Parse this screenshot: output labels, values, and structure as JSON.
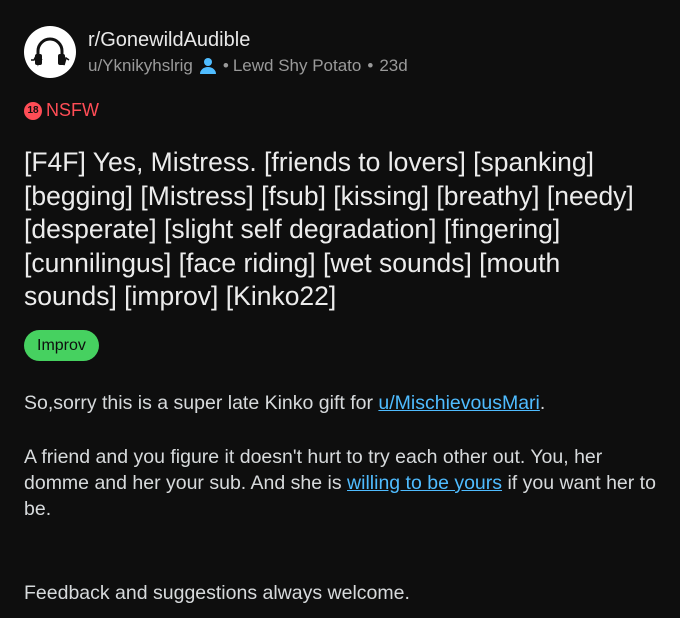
{
  "post": {
    "subreddit": "r/GonewildAudible",
    "author": "u/Yknikyhslrig",
    "author_flair": "Lewd Shy Potato",
    "separator": "•",
    "age": "23d",
    "nsfw_badge": "18",
    "nsfw_label": "NSFW",
    "title": "[F4F] Yes, Mistress. [friends to lovers] [spanking] [begging] [Mistress] [fsub] [kissing] [breathy] [needy] [desperate] [slight self degradation] [fingering] [cunnilingus] [face riding] [wet sounds] [mouth sounds] [improv] [Kinko22]",
    "link_flair": "Improv",
    "body": {
      "p1_before": "So,sorry this is a super late Kinko gift for ",
      "p1_link": "u/MischievousMari",
      "p1_after": ".",
      "p2_before": "A friend and you figure it doesn't hurt to try each other out. You, her domme and her your sub. And she is ",
      "p2_link": "willing to be yours",
      "p2_after": " if you want her to be.",
      "p3": "Feedback and suggestions always welcome."
    }
  },
  "colors": {
    "background": "#0e0e0e",
    "nsfw": "#ff4d56",
    "flair": "#46d160",
    "link": "#4fbcff",
    "user_icon": "#4fbcff"
  },
  "icons": {
    "subreddit_avatar": "headphones-waveform-icon",
    "user": "user-icon"
  }
}
